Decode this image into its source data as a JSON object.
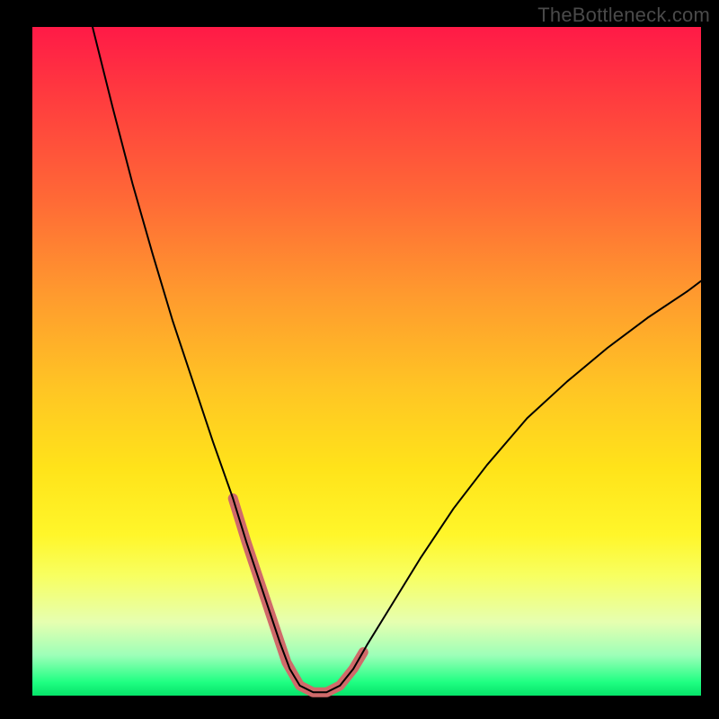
{
  "watermark": "TheBottleneck.com",
  "chart_data": {
    "type": "line",
    "title": "",
    "xlabel": "",
    "ylabel": "",
    "xlim": [
      0,
      100
    ],
    "ylim": [
      0,
      100
    ],
    "grid": false,
    "legend": false,
    "series": [
      {
        "name": "curve",
        "stroke": "#000000",
        "stroke_width": 2,
        "x": [
          9.0,
          12.0,
          15.0,
          18.0,
          21.0,
          24.0,
          27.0,
          30.0,
          32.0,
          34.0,
          35.5,
          37.0,
          38.5,
          40.0,
          42.0,
          44.0,
          46.0,
          48.0,
          50.0,
          54.0,
          58.0,
          63.0,
          68.0,
          74.0,
          80.0,
          86.0,
          92.0,
          98.0,
          100.0
        ],
        "y": [
          100.0,
          88.0,
          76.5,
          66.0,
          56.0,
          47.0,
          38.0,
          29.5,
          23.0,
          17.0,
          12.5,
          8.0,
          4.0,
          1.5,
          0.5,
          0.5,
          1.5,
          4.0,
          7.5,
          14.0,
          20.5,
          28.0,
          34.5,
          41.5,
          47.0,
          52.0,
          56.5,
          60.5,
          62.0
        ]
      },
      {
        "name": "marker-band",
        "stroke": "#d06a6a",
        "stroke_width": 11,
        "x": [
          30.0,
          32.0,
          34.0,
          35.5,
          37.0,
          38.0,
          40.0,
          42.0,
          44.0,
          46.0,
          48.0,
          49.5
        ],
        "y": [
          29.5,
          23.0,
          17.0,
          12.5,
          8.0,
          5.0,
          1.5,
          0.5,
          0.5,
          1.5,
          4.0,
          6.5
        ]
      }
    ],
    "background": {
      "type": "vertical-gradient",
      "stops": [
        {
          "pos": 0.0,
          "color": "#ff1a47"
        },
        {
          "pos": 0.1,
          "color": "#ff3a3f"
        },
        {
          "pos": 0.26,
          "color": "#ff6a36"
        },
        {
          "pos": 0.4,
          "color": "#ff9a2e"
        },
        {
          "pos": 0.54,
          "color": "#ffc524"
        },
        {
          "pos": 0.66,
          "color": "#ffe31a"
        },
        {
          "pos": 0.76,
          "color": "#fff62a"
        },
        {
          "pos": 0.82,
          "color": "#f8ff60"
        },
        {
          "pos": 0.89,
          "color": "#e6ffb0"
        },
        {
          "pos": 0.94,
          "color": "#9cffb8"
        },
        {
          "pos": 0.98,
          "color": "#1fff82"
        },
        {
          "pos": 1.0,
          "color": "#06e269"
        }
      ]
    }
  }
}
